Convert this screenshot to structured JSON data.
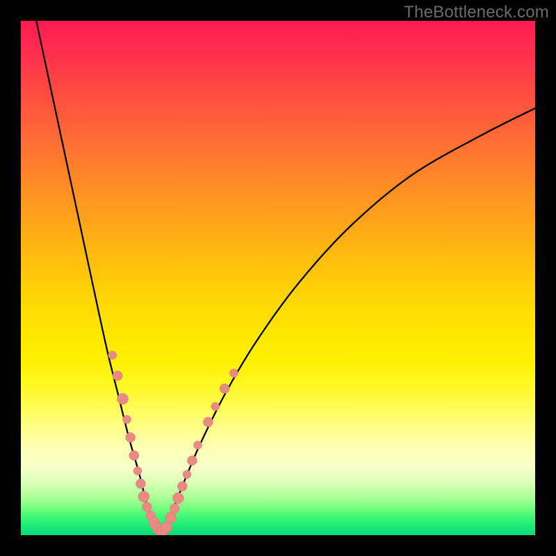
{
  "watermark": "TheBottleneck.com",
  "colors": {
    "curve": "#000000",
    "dot_fill": "#e98b83",
    "dot_stroke": "#d9776f"
  },
  "chart_data": {
    "type": "line",
    "title": "",
    "xlabel": "",
    "ylabel": "",
    "xlim": [
      0,
      100
    ],
    "ylim": [
      0,
      100
    ],
    "grid": false,
    "legend": false,
    "note": "Percent values estimated from pixel positions; axes are not labeled in source image.",
    "series": [
      {
        "name": "bottleneck-curve",
        "x": [
          3,
          6,
          9,
          12,
          15,
          17,
          19,
          21,
          23,
          24.5,
          26,
          27,
          28,
          30,
          32,
          35,
          40,
          46,
          54,
          64,
          76,
          90,
          100
        ],
        "y": [
          100,
          86,
          72,
          58,
          44,
          35,
          27,
          19,
          12,
          6,
          2,
          0.5,
          1.5,
          6,
          11,
          18,
          28,
          38,
          49,
          60,
          70,
          78,
          83
        ]
      }
    ],
    "scatter": [
      {
        "name": "left-cluster-dots",
        "points": [
          {
            "x": 17.8,
            "y": 35.0,
            "r": 6
          },
          {
            "x": 18.8,
            "y": 31.0,
            "r": 7
          },
          {
            "x": 19.8,
            "y": 26.5,
            "r": 8
          },
          {
            "x": 20.6,
            "y": 22.5,
            "r": 6
          },
          {
            "x": 21.3,
            "y": 19.0,
            "r": 7
          },
          {
            "x": 22.0,
            "y": 15.5,
            "r": 7
          },
          {
            "x": 22.7,
            "y": 12.5,
            "r": 6
          },
          {
            "x": 23.3,
            "y": 10.0,
            "r": 7
          },
          {
            "x": 23.9,
            "y": 7.5,
            "r": 8
          },
          {
            "x": 24.5,
            "y": 5.5,
            "r": 7
          },
          {
            "x": 25.2,
            "y": 3.8,
            "r": 7
          },
          {
            "x": 25.9,
            "y": 2.4,
            "r": 8
          },
          {
            "x": 26.6,
            "y": 1.3,
            "r": 8
          },
          {
            "x": 27.4,
            "y": 0.7,
            "r": 8
          }
        ]
      },
      {
        "name": "right-cluster-dots",
        "points": [
          {
            "x": 28.3,
            "y": 1.5,
            "r": 8
          },
          {
            "x": 29.1,
            "y": 3.4,
            "r": 8
          },
          {
            "x": 29.9,
            "y": 5.2,
            "r": 7
          },
          {
            "x": 30.6,
            "y": 7.2,
            "r": 8
          },
          {
            "x": 31.4,
            "y": 9.5,
            "r": 7
          },
          {
            "x": 32.3,
            "y": 11.8,
            "r": 6
          },
          {
            "x": 33.3,
            "y": 14.5,
            "r": 7
          },
          {
            "x": 34.4,
            "y": 17.5,
            "r": 6
          },
          {
            "x": 36.4,
            "y": 22.0,
            "r": 7
          },
          {
            "x": 37.8,
            "y": 25.0,
            "r": 6
          },
          {
            "x": 39.6,
            "y": 28.5,
            "r": 7
          },
          {
            "x": 41.4,
            "y": 31.5,
            "r": 6
          }
        ]
      }
    ]
  }
}
